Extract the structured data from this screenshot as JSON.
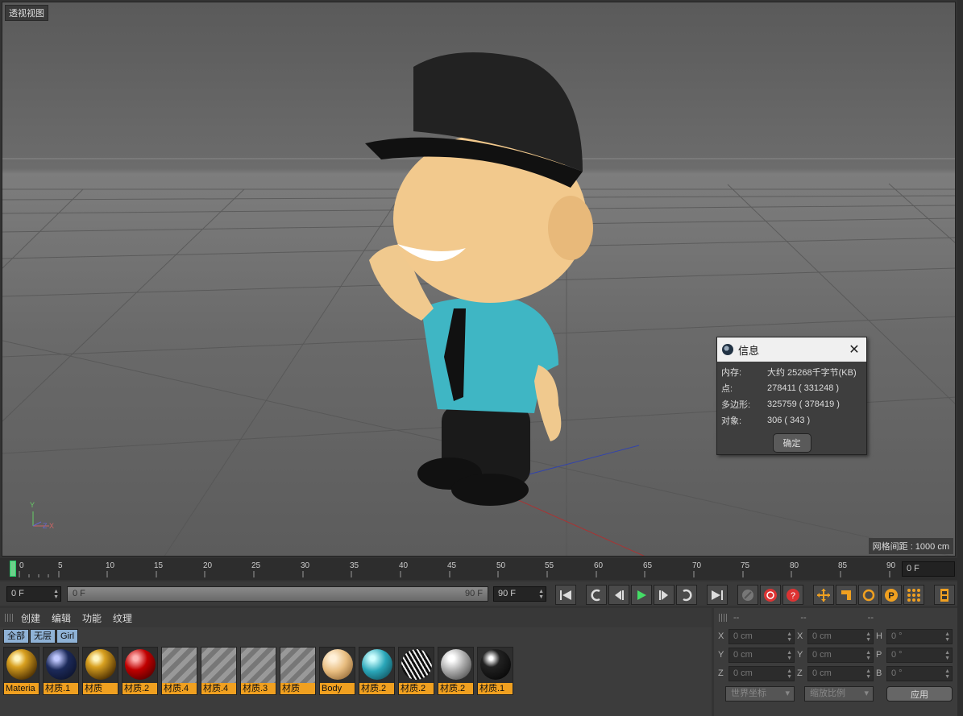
{
  "viewport": {
    "title": "透视视图",
    "grid_spacing": "网格间距 : 1000 cm",
    "axis_labels": [
      "Y",
      "Z",
      "X"
    ]
  },
  "info_dialog": {
    "title": "信息",
    "close_icon": "close-icon",
    "rows": [
      {
        "key": "内存:",
        "value": "大约 25268千字节(KB)"
      },
      {
        "key": "点:",
        "value": "278411 ( 331248 )"
      },
      {
        "key": "多边形:",
        "value": "325759 ( 378419 )"
      },
      {
        "key": "对象:",
        "value": "306 ( 343 )"
      }
    ],
    "ok_label": "确定"
  },
  "timeline": {
    "ticks": [
      "0",
      "5",
      "10",
      "15",
      "20",
      "25",
      "30",
      "35",
      "40",
      "45",
      "50",
      "55",
      "60",
      "65",
      "70",
      "75",
      "80",
      "85",
      "90"
    ],
    "current_frame": "0 F"
  },
  "transport": {
    "start_field": "0 F",
    "range_start": "0 F",
    "range_end": "90 F",
    "end_field": "90 F"
  },
  "materials": {
    "menu": [
      "创建",
      "编辑",
      "功能",
      "纹理"
    ],
    "filters": [
      "全部",
      "无层",
      "Girl"
    ],
    "items": [
      {
        "name": "Materia",
        "style": "gold"
      },
      {
        "name": "材质.1",
        "style": "navy"
      },
      {
        "name": "材质",
        "style": "gold"
      },
      {
        "name": "材质.2",
        "style": "red"
      },
      {
        "name": "材质.4",
        "style": "tex"
      },
      {
        "name": "材质.4",
        "style": "tex"
      },
      {
        "name": "材质.3",
        "style": "tex"
      },
      {
        "name": "材质",
        "style": "tex"
      },
      {
        "name": "Body",
        "style": "skin"
      },
      {
        "name": "材质.2",
        "style": "cyan"
      },
      {
        "name": "材质.2",
        "style": "zebra"
      },
      {
        "name": "材质.2",
        "style": "grey"
      },
      {
        "name": "材质.1",
        "style": "black"
      }
    ]
  },
  "coordinates": {
    "headers": [
      "--",
      "--",
      "--"
    ],
    "rows": [
      {
        "a": "X",
        "av": "0 cm",
        "b": "X",
        "bv": "0 cm",
        "c": "H",
        "cv": "0 °"
      },
      {
        "a": "Y",
        "av": "0 cm",
        "b": "Y",
        "bv": "0 cm",
        "c": "P",
        "cv": "0 °"
      },
      {
        "a": "Z",
        "av": "0 cm",
        "b": "Z",
        "bv": "0 cm",
        "c": "B",
        "cv": "0 °"
      }
    ],
    "world_dropdown": "世界坐标",
    "scale_dropdown": "缩放比例",
    "apply_label": "应用"
  },
  "colors": {
    "accent_orange": "#f0a020",
    "playhead_green": "#6dcf8a",
    "filter_blue": "#8fb2d6"
  }
}
